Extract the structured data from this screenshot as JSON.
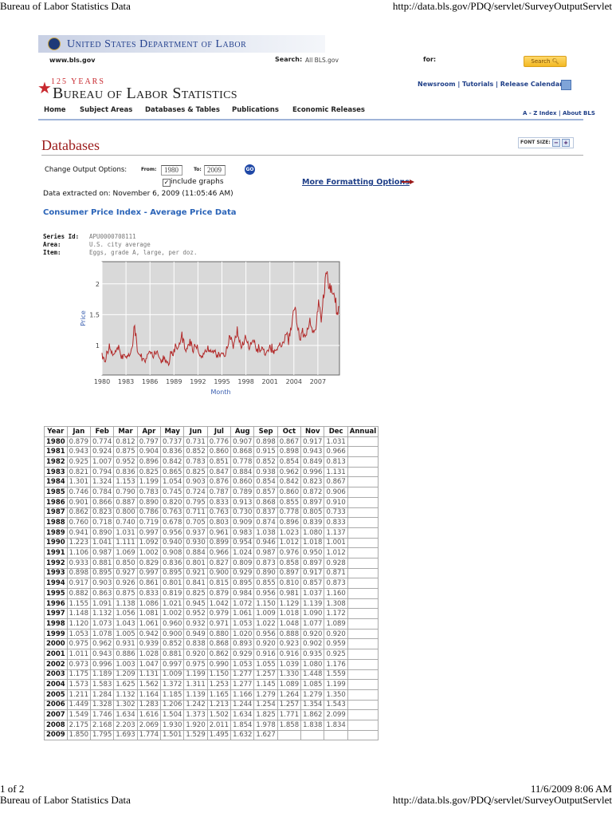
{
  "print_header": {
    "title": "Bureau of Labor Statistics Data",
    "url": "http://data.bls.gov/PDQ/servlet/SurveyOutputServlet"
  },
  "print_footer": {
    "page": "1 of 2",
    "datetime": "11/6/2009 8:06 AM",
    "title": "Bureau of Labor Statistics Data",
    "url": "http://data.bls.gov/PDQ/servlet/SurveyOutputServlet"
  },
  "header": {
    "dol_title": "United States Department of Labor",
    "site": "www.bls.gov",
    "search_label": "Search:",
    "search_scope": "All BLS.gov",
    "for_label": "for:",
    "search_button": "Search",
    "anniversary": "125 YEARS",
    "bls_title": "Bureau of Labor Statistics",
    "top_links": [
      "Newsroom",
      "Tutorials",
      "Release Calendar"
    ],
    "nav": [
      "Home",
      "Subject Areas",
      "Databases & Tables",
      "Publications",
      "Economic Releases"
    ],
    "util_links": [
      "A - Z Index",
      "About BLS"
    ]
  },
  "page": {
    "title": "Databases",
    "font_size_label": "FONT SIZE:",
    "change_output": "Change Output Options:",
    "from_label": "From:",
    "from_value": "1980",
    "to_label": "To:",
    "to_value": "2009",
    "go": "GO",
    "include_graphs": "include graphs",
    "include_graphs_checked": true,
    "more_formatting": "More Formatting Options",
    "extracted": "Data extracted on: November 6, 2009 (11:05:46 AM)",
    "section_title": "Consumer Price Index - Average Price Data",
    "series": [
      {
        "label": "Series Id:",
        "value": "APU0000708111"
      },
      {
        "label": "Area:",
        "value": "U.S. city average"
      },
      {
        "label": "Item:",
        "value": "Eggs, grade A, large, per doz."
      }
    ]
  },
  "table": {
    "headers": [
      "Year",
      "Jan",
      "Feb",
      "Mar",
      "Apr",
      "May",
      "Jun",
      "Jul",
      "Aug",
      "Sep",
      "Oct",
      "Nov",
      "Dec",
      "Annual"
    ],
    "rows": [
      [
        "1980",
        "0.879",
        "0.774",
        "0.812",
        "0.797",
        "0.737",
        "0.731",
        "0.776",
        "0.907",
        "0.898",
        "0.867",
        "0.917",
        "1.031",
        ""
      ],
      [
        "1981",
        "0.943",
        "0.924",
        "0.875",
        "0.904",
        "0.836",
        "0.852",
        "0.860",
        "0.868",
        "0.915",
        "0.898",
        "0.943",
        "0.966",
        ""
      ],
      [
        "1982",
        "0.925",
        "1.007",
        "0.952",
        "0.896",
        "0.842",
        "0.783",
        "0.851",
        "0.778",
        "0.852",
        "0.854",
        "0.849",
        "0.813",
        ""
      ],
      [
        "1983",
        "0.821",
        "0.794",
        "0.836",
        "0.825",
        "0.865",
        "0.825",
        "0.847",
        "0.884",
        "0.938",
        "0.962",
        "0.996",
        "1.131",
        ""
      ],
      [
        "1984",
        "1.301",
        "1.324",
        "1.153",
        "1.199",
        "1.054",
        "0.903",
        "0.876",
        "0.860",
        "0.854",
        "0.842",
        "0.823",
        "0.867",
        ""
      ],
      [
        "1985",
        "0.746",
        "0.784",
        "0.790",
        "0.783",
        "0.745",
        "0.724",
        "0.787",
        "0.789",
        "0.857",
        "0.860",
        "0.872",
        "0.906",
        ""
      ],
      [
        "1986",
        "0.901",
        "0.866",
        "0.887",
        "0.890",
        "0.820",
        "0.795",
        "0.833",
        "0.913",
        "0.868",
        "0.855",
        "0.897",
        "0.910",
        ""
      ],
      [
        "1987",
        "0.862",
        "0.823",
        "0.800",
        "0.786",
        "0.763",
        "0.711",
        "0.763",
        "0.730",
        "0.837",
        "0.778",
        "0.805",
        "0.733",
        ""
      ],
      [
        "1988",
        "0.760",
        "0.718",
        "0.740",
        "0.719",
        "0.678",
        "0.705",
        "0.803",
        "0.909",
        "0.874",
        "0.896",
        "0.839",
        "0.833",
        ""
      ],
      [
        "1989",
        "0.941",
        "0.890",
        "1.031",
        "0.997",
        "0.956",
        "0.937",
        "0.961",
        "0.983",
        "1.038",
        "1.023",
        "1.080",
        "1.137",
        ""
      ],
      [
        "1990",
        "1.223",
        "1.041",
        "1.111",
        "1.092",
        "0.940",
        "0.930",
        "0.899",
        "0.954",
        "0.946",
        "1.012",
        "1.018",
        "1.001",
        ""
      ],
      [
        "1991",
        "1.106",
        "0.987",
        "1.069",
        "1.002",
        "0.908",
        "0.884",
        "0.966",
        "1.024",
        "0.987",
        "0.976",
        "0.950",
        "1.012",
        ""
      ],
      [
        "1992",
        "0.933",
        "0.881",
        "0.850",
        "0.829",
        "0.836",
        "0.801",
        "0.827",
        "0.809",
        "0.873",
        "0.858",
        "0.897",
        "0.928",
        ""
      ],
      [
        "1993",
        "0.898",
        "0.895",
        "0.927",
        "0.997",
        "0.895",
        "0.921",
        "0.900",
        "0.929",
        "0.890",
        "0.897",
        "0.917",
        "0.871",
        ""
      ],
      [
        "1994",
        "0.917",
        "0.903",
        "0.926",
        "0.861",
        "0.801",
        "0.841",
        "0.815",
        "0.895",
        "0.855",
        "0.810",
        "0.857",
        "0.873",
        ""
      ],
      [
        "1995",
        "0.882",
        "0.863",
        "0.875",
        "0.833",
        "0.819",
        "0.825",
        "0.879",
        "0.984",
        "0.956",
        "0.981",
        "1.037",
        "1.160",
        ""
      ],
      [
        "1996",
        "1.155",
        "1.091",
        "1.138",
        "1.086",
        "1.021",
        "0.945",
        "1.042",
        "1.072",
        "1.150",
        "1.129",
        "1.139",
        "1.308",
        ""
      ],
      [
        "1997",
        "1.148",
        "1.132",
        "1.056",
        "1.081",
        "1.002",
        "0.952",
        "0.979",
        "1.061",
        "1.009",
        "1.018",
        "1.090",
        "1.172",
        ""
      ],
      [
        "1998",
        "1.120",
        "1.073",
        "1.043",
        "1.061",
        "0.960",
        "0.932",
        "0.971",
        "1.053",
        "1.022",
        "1.048",
        "1.077",
        "1.089",
        ""
      ],
      [
        "1999",
        "1.053",
        "1.078",
        "1.005",
        "0.942",
        "0.900",
        "0.949",
        "0.880",
        "1.020",
        "0.956",
        "0.888",
        "0.920",
        "0.920",
        ""
      ],
      [
        "2000",
        "0.975",
        "0.962",
        "0.931",
        "0.939",
        "0.852",
        "0.838",
        "0.868",
        "0.893",
        "0.920",
        "0.923",
        "0.902",
        "0.959",
        ""
      ],
      [
        "2001",
        "1.011",
        "0.943",
        "0.886",
        "1.028",
        "0.881",
        "0.920",
        "0.862",
        "0.929",
        "0.916",
        "0.916",
        "0.935",
        "0.925",
        ""
      ],
      [
        "2002",
        "0.973",
        "0.996",
        "1.003",
        "1.047",
        "0.997",
        "0.975",
        "0.990",
        "1.053",
        "1.055",
        "1.039",
        "1.080",
        "1.176",
        ""
      ],
      [
        "2003",
        "1.175",
        "1.189",
        "1.209",
        "1.131",
        "1.009",
        "1.199",
        "1.150",
        "1.277",
        "1.257",
        "1.330",
        "1.448",
        "1.559",
        ""
      ],
      [
        "2004",
        "1.573",
        "1.583",
        "1.625",
        "1.562",
        "1.372",
        "1.311",
        "1.253",
        "1.277",
        "1.145",
        "1.089",
        "1.085",
        "1.199",
        ""
      ],
      [
        "2005",
        "1.211",
        "1.284",
        "1.132",
        "1.164",
        "1.185",
        "1.139",
        "1.165",
        "1.166",
        "1.279",
        "1.264",
        "1.279",
        "1.350",
        ""
      ],
      [
        "2006",
        "1.449",
        "1.328",
        "1.302",
        "1.283",
        "1.206",
        "1.242",
        "1.213",
        "1.244",
        "1.254",
        "1.257",
        "1.354",
        "1.543",
        ""
      ],
      [
        "2007",
        "1.549",
        "1.746",
        "1.634",
        "1.616",
        "1.504",
        "1.373",
        "1.502",
        "1.634",
        "1.825",
        "1.771",
        "1.862",
        "2.099",
        ""
      ],
      [
        "2008",
        "2.175",
        "2.168",
        "2.203",
        "2.069",
        "1.930",
        "1.920",
        "2.011",
        "1.854",
        "1.978",
        "1.858",
        "1.838",
        "1.834",
        ""
      ],
      [
        "2009",
        "1.850",
        "1.795",
        "1.693",
        "1.774",
        "1.501",
        "1.529",
        "1.495",
        "1.632",
        "1.627",
        "",
        "",
        "",
        ""
      ]
    ]
  },
  "chart_data": {
    "type": "line",
    "title": "",
    "xlabel": "Month",
    "ylabel": "Price",
    "xlim": [
      1980,
      2009.7
    ],
    "ylim": [
      0.52,
      2.36
    ],
    "x_ticks": [
      "1980",
      "1983",
      "1986",
      "1989",
      "1992",
      "1995",
      "1998",
      "2001",
      "2004",
      "2007"
    ],
    "y_ticks": [
      "1",
      "1.5",
      "2"
    ],
    "grid": true,
    "line_color": "#b22a2a",
    "source": "monthly values from table.rows (Jan 1980 - Sep 2009)"
  }
}
